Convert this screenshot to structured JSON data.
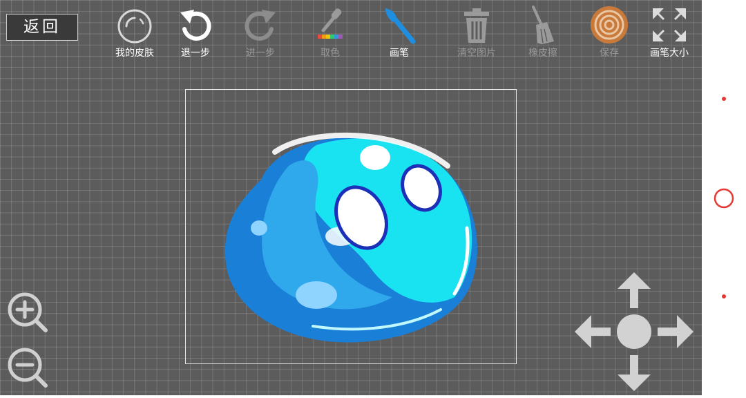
{
  "back_button": {
    "label": "返回"
  },
  "toolbar": {
    "my_skin": "我的皮肤",
    "undo": "退一步",
    "redo": "进一步",
    "pick_color": "取色",
    "brush": "画笔",
    "clear": "清空图片",
    "eraser": "橡皮擦",
    "save": "保存",
    "brush_size": "画笔大小"
  },
  "colors": {
    "canvas_bg": "#5c5c5c",
    "active_tool": "#1e8fe0",
    "inactive_label": "#9a9a9a",
    "save_icon": "#c97a3a",
    "nav_accent": "#e53935",
    "slime_dark": "#1a7fd6",
    "slime_light": "#19e3f0"
  },
  "icons": {
    "my_skin": "bubble-icon",
    "undo": "undo-arrow-icon",
    "redo": "redo-arrow-icon",
    "pick_color": "eyedropper-icon",
    "brush": "paintbrush-icon",
    "clear": "trash-can-icon",
    "eraser": "broom-icon",
    "save": "target-icon",
    "brush_size": "expand-arrows-icon",
    "zoom_in": "zoom-in-icon",
    "zoom_out": "zoom-out-icon",
    "dpad": "directional-pad-icon"
  }
}
